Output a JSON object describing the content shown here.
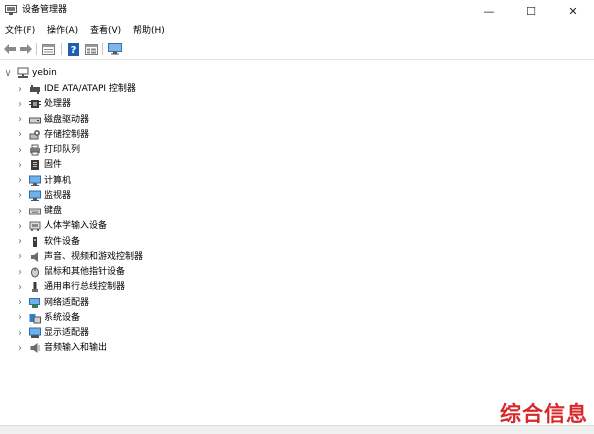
{
  "window": {
    "title": "设备管理器",
    "minimize_glyph": "—",
    "maximize_glyph": "☐",
    "close_glyph": "✕"
  },
  "menu": [
    {
      "label": "文件(F)"
    },
    {
      "label": "操作(A)"
    },
    {
      "label": "查看(V)"
    },
    {
      "label": "帮助(H)"
    }
  ],
  "toolbar": {
    "icons": [
      "back-icon",
      "forward-icon",
      "properties-icon",
      "help-icon",
      "details-view-icon",
      "monitor-icon"
    ]
  },
  "tree": {
    "root": {
      "label": "yebin",
      "expand_glyph": "∨"
    },
    "collapse_glyph": "›",
    "items": [
      {
        "label": "IDE ATA/ATAPI 控制器",
        "icon": "ide-controller-icon"
      },
      {
        "label": "处理器",
        "icon": "processor-icon"
      },
      {
        "label": "磁盘驱动器",
        "icon": "disk-drive-icon"
      },
      {
        "label": "存储控制器",
        "icon": "storage-controller-icon"
      },
      {
        "label": "打印队列",
        "icon": "printer-icon"
      },
      {
        "label": "固件",
        "icon": "firmware-icon"
      },
      {
        "label": "计算机",
        "icon": "computer-icon"
      },
      {
        "label": "监视器",
        "icon": "monitor-icon"
      },
      {
        "label": "键盘",
        "icon": "keyboard-icon"
      },
      {
        "label": "人体学输入设备",
        "icon": "hid-icon"
      },
      {
        "label": "软件设备",
        "icon": "software-device-icon"
      },
      {
        "label": "声音、视频和游戏控制器",
        "icon": "speaker-icon"
      },
      {
        "label": "鼠标和其他指针设备",
        "icon": "mouse-icon"
      },
      {
        "label": "通用串行总线控制器",
        "icon": "usb-icon"
      },
      {
        "label": "网络适配器",
        "icon": "network-adapter-icon"
      },
      {
        "label": "系统设备",
        "icon": "system-device-icon"
      },
      {
        "label": "显示适配器",
        "icon": "display-adapter-icon"
      },
      {
        "label": "音频输入和输出",
        "icon": "audio-io-icon"
      }
    ]
  },
  "watermark": "综合信息",
  "colors": {
    "watermark": "#d8282b",
    "icon_blue": "#2f7fd0",
    "icon_gray": "#6b6b6b",
    "help_blue": "#1e5fb4"
  }
}
